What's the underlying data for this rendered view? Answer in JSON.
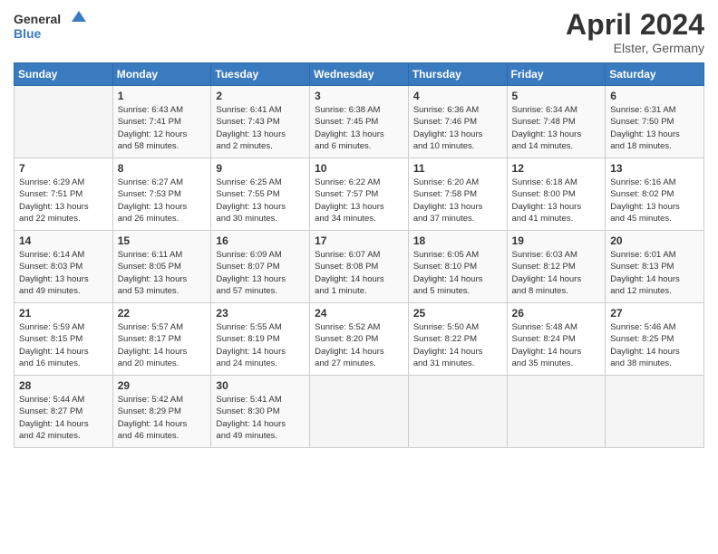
{
  "header": {
    "logo_line1": "General",
    "logo_line2": "Blue",
    "month_year": "April 2024",
    "location": "Elster, Germany"
  },
  "weekdays": [
    "Sunday",
    "Monday",
    "Tuesday",
    "Wednesday",
    "Thursday",
    "Friday",
    "Saturday"
  ],
  "weeks": [
    [
      {
        "day": "",
        "text": ""
      },
      {
        "day": "1",
        "text": "Sunrise: 6:43 AM\nSunset: 7:41 PM\nDaylight: 12 hours\nand 58 minutes."
      },
      {
        "day": "2",
        "text": "Sunrise: 6:41 AM\nSunset: 7:43 PM\nDaylight: 13 hours\nand 2 minutes."
      },
      {
        "day": "3",
        "text": "Sunrise: 6:38 AM\nSunset: 7:45 PM\nDaylight: 13 hours\nand 6 minutes."
      },
      {
        "day": "4",
        "text": "Sunrise: 6:36 AM\nSunset: 7:46 PM\nDaylight: 13 hours\nand 10 minutes."
      },
      {
        "day": "5",
        "text": "Sunrise: 6:34 AM\nSunset: 7:48 PM\nDaylight: 13 hours\nand 14 minutes."
      },
      {
        "day": "6",
        "text": "Sunrise: 6:31 AM\nSunset: 7:50 PM\nDaylight: 13 hours\nand 18 minutes."
      }
    ],
    [
      {
        "day": "7",
        "text": "Sunrise: 6:29 AM\nSunset: 7:51 PM\nDaylight: 13 hours\nand 22 minutes."
      },
      {
        "day": "8",
        "text": "Sunrise: 6:27 AM\nSunset: 7:53 PM\nDaylight: 13 hours\nand 26 minutes."
      },
      {
        "day": "9",
        "text": "Sunrise: 6:25 AM\nSunset: 7:55 PM\nDaylight: 13 hours\nand 30 minutes."
      },
      {
        "day": "10",
        "text": "Sunrise: 6:22 AM\nSunset: 7:57 PM\nDaylight: 13 hours\nand 34 minutes."
      },
      {
        "day": "11",
        "text": "Sunrise: 6:20 AM\nSunset: 7:58 PM\nDaylight: 13 hours\nand 37 minutes."
      },
      {
        "day": "12",
        "text": "Sunrise: 6:18 AM\nSunset: 8:00 PM\nDaylight: 13 hours\nand 41 minutes."
      },
      {
        "day": "13",
        "text": "Sunrise: 6:16 AM\nSunset: 8:02 PM\nDaylight: 13 hours\nand 45 minutes."
      }
    ],
    [
      {
        "day": "14",
        "text": "Sunrise: 6:14 AM\nSunset: 8:03 PM\nDaylight: 13 hours\nand 49 minutes."
      },
      {
        "day": "15",
        "text": "Sunrise: 6:11 AM\nSunset: 8:05 PM\nDaylight: 13 hours\nand 53 minutes."
      },
      {
        "day": "16",
        "text": "Sunrise: 6:09 AM\nSunset: 8:07 PM\nDaylight: 13 hours\nand 57 minutes."
      },
      {
        "day": "17",
        "text": "Sunrise: 6:07 AM\nSunset: 8:08 PM\nDaylight: 14 hours\nand 1 minute."
      },
      {
        "day": "18",
        "text": "Sunrise: 6:05 AM\nSunset: 8:10 PM\nDaylight: 14 hours\nand 5 minutes."
      },
      {
        "day": "19",
        "text": "Sunrise: 6:03 AM\nSunset: 8:12 PM\nDaylight: 14 hours\nand 8 minutes."
      },
      {
        "day": "20",
        "text": "Sunrise: 6:01 AM\nSunset: 8:13 PM\nDaylight: 14 hours\nand 12 minutes."
      }
    ],
    [
      {
        "day": "21",
        "text": "Sunrise: 5:59 AM\nSunset: 8:15 PM\nDaylight: 14 hours\nand 16 minutes."
      },
      {
        "day": "22",
        "text": "Sunrise: 5:57 AM\nSunset: 8:17 PM\nDaylight: 14 hours\nand 20 minutes."
      },
      {
        "day": "23",
        "text": "Sunrise: 5:55 AM\nSunset: 8:19 PM\nDaylight: 14 hours\nand 24 minutes."
      },
      {
        "day": "24",
        "text": "Sunrise: 5:52 AM\nSunset: 8:20 PM\nDaylight: 14 hours\nand 27 minutes."
      },
      {
        "day": "25",
        "text": "Sunrise: 5:50 AM\nSunset: 8:22 PM\nDaylight: 14 hours\nand 31 minutes."
      },
      {
        "day": "26",
        "text": "Sunrise: 5:48 AM\nSunset: 8:24 PM\nDaylight: 14 hours\nand 35 minutes."
      },
      {
        "day": "27",
        "text": "Sunrise: 5:46 AM\nSunset: 8:25 PM\nDaylight: 14 hours\nand 38 minutes."
      }
    ],
    [
      {
        "day": "28",
        "text": "Sunrise: 5:44 AM\nSunset: 8:27 PM\nDaylight: 14 hours\nand 42 minutes."
      },
      {
        "day": "29",
        "text": "Sunrise: 5:42 AM\nSunset: 8:29 PM\nDaylight: 14 hours\nand 46 minutes."
      },
      {
        "day": "30",
        "text": "Sunrise: 5:41 AM\nSunset: 8:30 PM\nDaylight: 14 hours\nand 49 minutes."
      },
      {
        "day": "",
        "text": ""
      },
      {
        "day": "",
        "text": ""
      },
      {
        "day": "",
        "text": ""
      },
      {
        "day": "",
        "text": ""
      }
    ]
  ]
}
